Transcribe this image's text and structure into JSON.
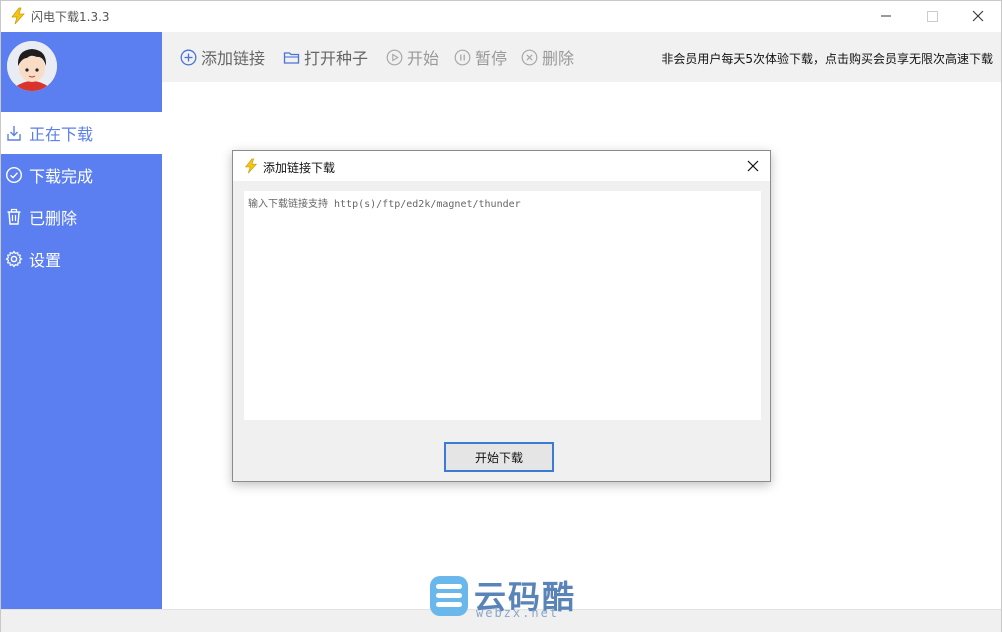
{
  "app": {
    "title": "闪电下载1.3.3"
  },
  "window_controls": {
    "minimize": "minimize-icon",
    "maximize": "maximize-icon",
    "close": "close-icon"
  },
  "sidebar": {
    "avatar_icon": "user-avatar",
    "items": [
      {
        "label": "正在下载",
        "icon": "download-icon",
        "active": true
      },
      {
        "label": "下载完成",
        "icon": "check-circle-icon",
        "active": false
      },
      {
        "label": "已删除",
        "icon": "trash-icon",
        "active": false
      },
      {
        "label": "设置",
        "icon": "gear-icon",
        "active": false
      }
    ]
  },
  "toolbar": {
    "add_link": "添加链接",
    "open_torrent": "打开种子",
    "start": "开始",
    "pause": "暂停",
    "delete": "删除",
    "notice": "非会员用户每天5次体验下载，点击购买会员享无限次高速下载"
  },
  "dialog": {
    "title": "添加链接下载",
    "textarea_placeholder": "输入下载链接支持 http(s)/ftp/ed2k/magnet/thunder",
    "submit_label": "开始下载"
  },
  "watermark": {
    "text": "云码酷",
    "sub": "webzx.net"
  },
  "colors": {
    "sidebar": "#5b7ff0",
    "toolbar": "#f1f1f1",
    "dialog_button_border": "#3b7bd6"
  }
}
